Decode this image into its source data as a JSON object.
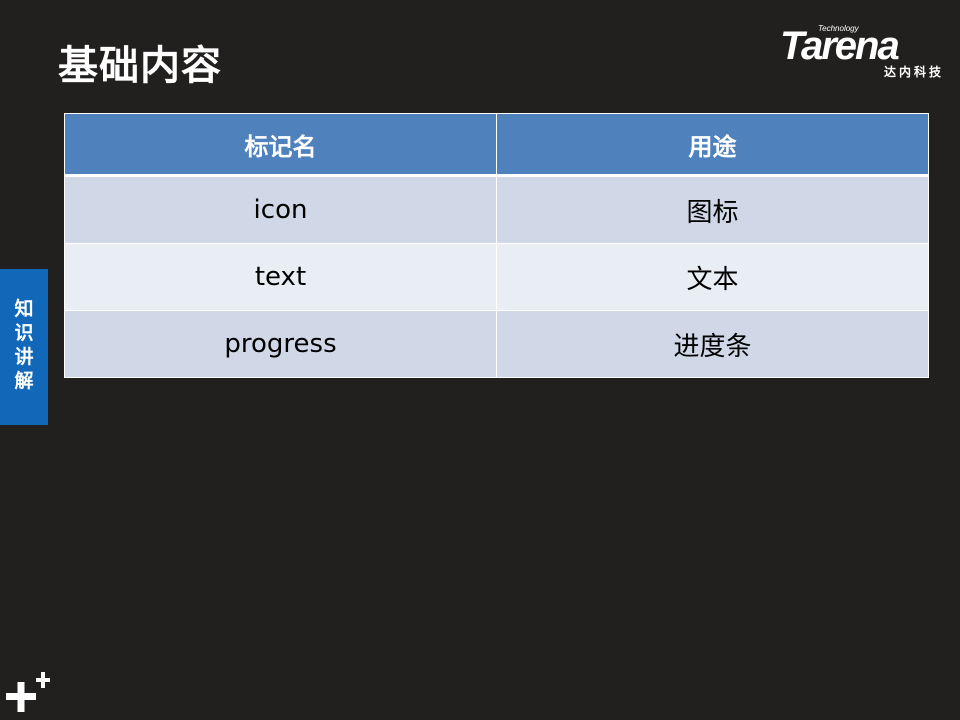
{
  "slide": {
    "title": "基础内容",
    "side_tab": "知识讲解"
  },
  "logo": {
    "tagline": "Technology",
    "name": "Tarena",
    "cn": "达内科技"
  },
  "table": {
    "headers": [
      "标记名",
      "用途"
    ],
    "rows": [
      [
        "icon",
        "图标"
      ],
      [
        "text",
        "文本"
      ],
      [
        "progress",
        "进度条"
      ]
    ]
  },
  "colors": {
    "background": "#221f1f",
    "header": "#4f81bd",
    "row_odd": "#d0d8e8",
    "row_even": "#e9edf4",
    "side_tab": "#1268b8"
  },
  "icons": [
    "plus-icon"
  ]
}
